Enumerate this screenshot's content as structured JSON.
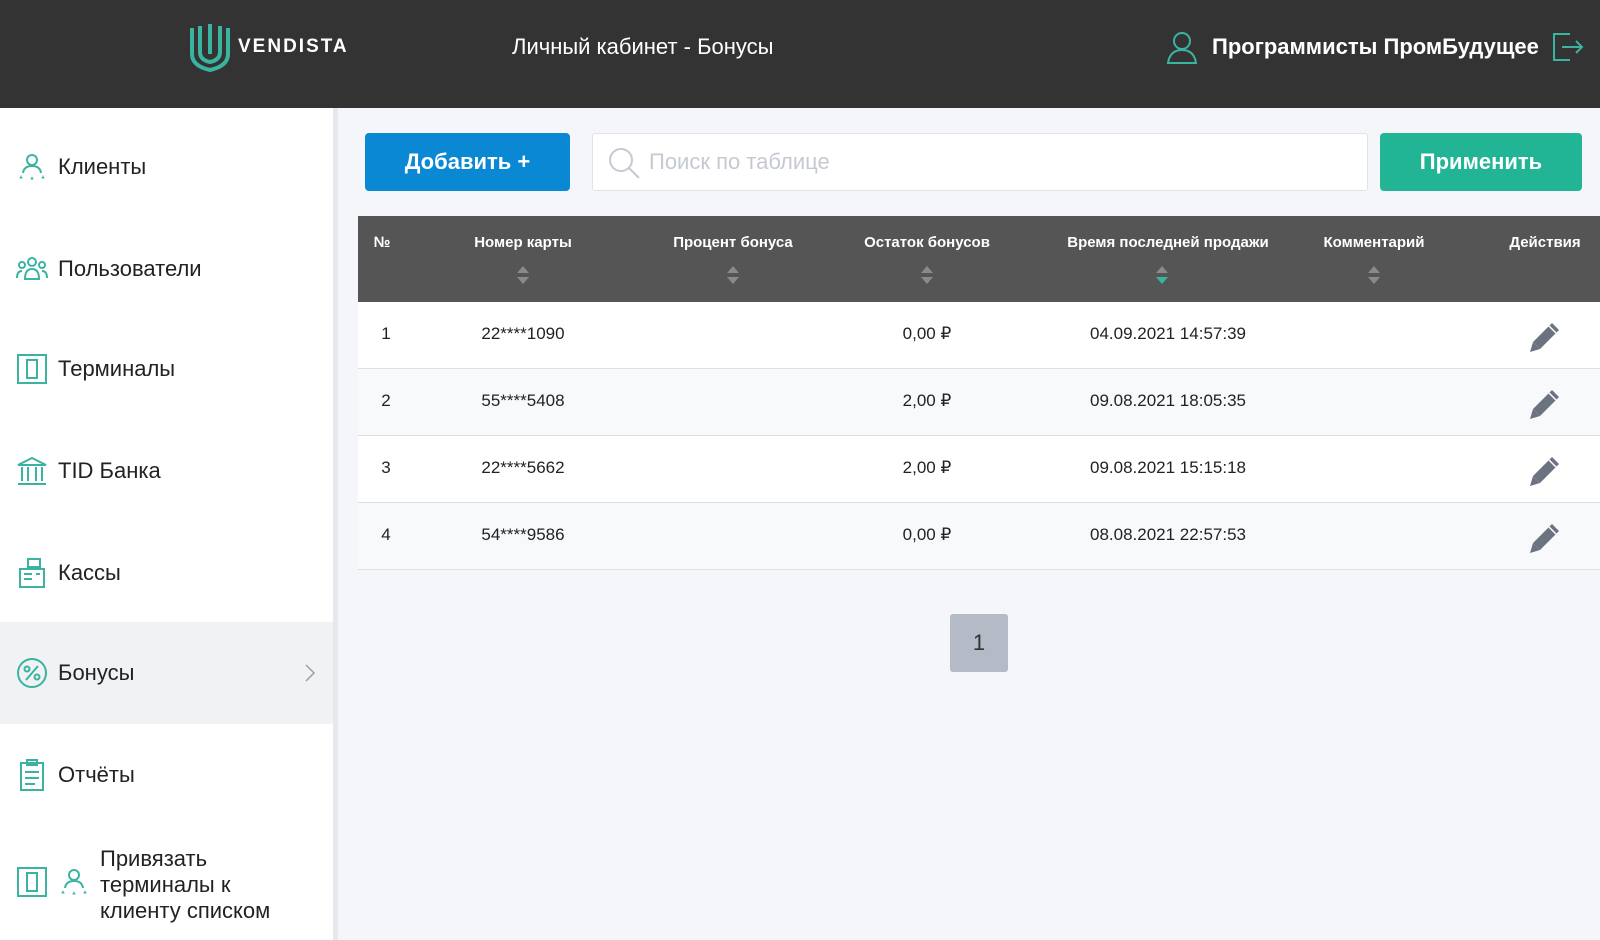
{
  "header": {
    "logo_text": "VENDISTA",
    "title": "Личный кабинет - Бонусы",
    "user_name": "Программисты ПромБудущее"
  },
  "sidebar": {
    "items": [
      {
        "label": "Клиенты",
        "icon": "clients-icon"
      },
      {
        "label": "Пользователи",
        "icon": "users-icon"
      },
      {
        "label": "Терминалы",
        "icon": "terminal-icon"
      },
      {
        "label": "TID Банка",
        "icon": "bank-icon"
      },
      {
        "label": "Кассы",
        "icon": "cash-register-icon"
      },
      {
        "label": "Бонусы",
        "icon": "percent-icon",
        "active": true
      },
      {
        "label": "Отчёты",
        "icon": "report-icon"
      },
      {
        "label": "Привязать терминалы к клиенту списком",
        "icon": "terminal-clients-icon"
      }
    ]
  },
  "toolbar": {
    "add_label": "Добавить +",
    "search_placeholder": "Поиск по таблице",
    "apply_label": "Применить"
  },
  "table": {
    "columns": [
      "№",
      "Номер карты",
      "Процент бонуса",
      "Остаток бонусов",
      "Время последней продажи",
      "Комментарий",
      "Действия"
    ],
    "sorted_column": "Время последней продажи",
    "rows": [
      {
        "n": "1",
        "card": "22****1090",
        "percent": "",
        "balance": "0,00 ₽",
        "last_sale": "04.09.2021 14:57:39",
        "comment": ""
      },
      {
        "n": "2",
        "card": "55****5408",
        "percent": "",
        "balance": "2,00 ₽",
        "last_sale": "09.08.2021 18:05:35",
        "comment": ""
      },
      {
        "n": "3",
        "card": "22****5662",
        "percent": "",
        "balance": "2,00 ₽",
        "last_sale": "09.08.2021 15:15:18",
        "comment": ""
      },
      {
        "n": "4",
        "card": "54****9586",
        "percent": "",
        "balance": "0,00 ₽",
        "last_sale": "08.08.2021 22:57:53",
        "comment": ""
      }
    ]
  },
  "pagination": {
    "current_page": "1"
  },
  "colors": {
    "header_bg": "#333333",
    "accent_teal": "#22b595",
    "add_blue": "#0a88d4",
    "table_header": "#555555",
    "icon_teal": "#3ab3a0"
  }
}
